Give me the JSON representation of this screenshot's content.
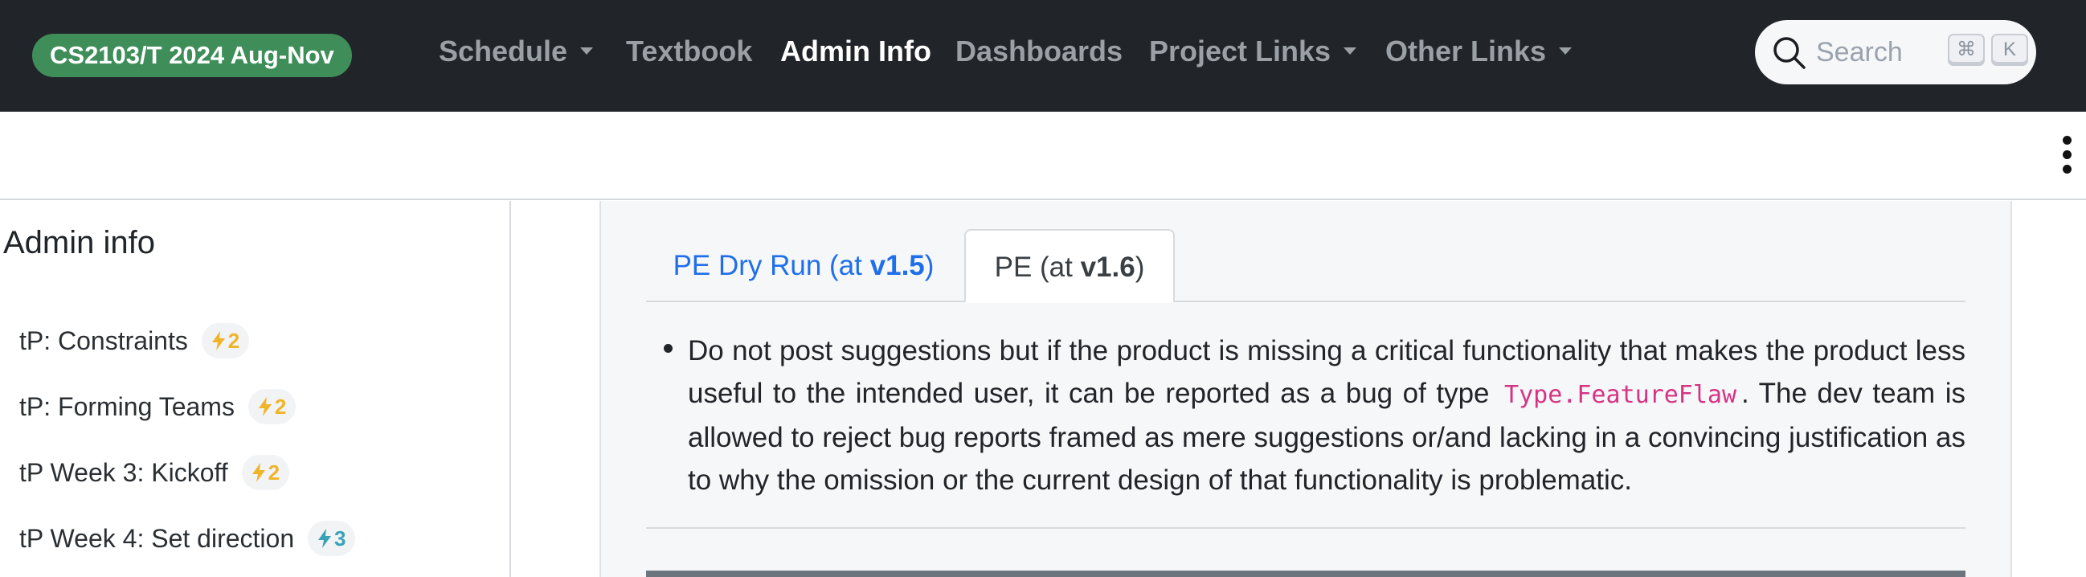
{
  "navbar": {
    "brand": "CS2103/T 2024 Aug-Nov",
    "items": [
      {
        "label": "Schedule",
        "dropdown": true,
        "active": false
      },
      {
        "label": "Textbook",
        "dropdown": false,
        "active": false
      },
      {
        "label": "Admin Info",
        "dropdown": false,
        "active": true
      },
      {
        "label": "Dashboards",
        "dropdown": false,
        "active": false
      },
      {
        "label": "Project Links",
        "dropdown": true,
        "active": false
      },
      {
        "label": "Other Links",
        "dropdown": true,
        "active": false
      }
    ],
    "search": {
      "placeholder": "Search",
      "shortcut_keys": [
        "⌘",
        "K"
      ]
    }
  },
  "subbar": {
    "menu_icon": "kebab-menu-icon"
  },
  "sidebar": {
    "title": "Admin info",
    "items": [
      {
        "label": "tP: Constraints",
        "badge": "2",
        "badge_color": "#f0b429"
      },
      {
        "label": "tP: Forming Teams",
        "badge": "2",
        "badge_color": "#f0b429"
      },
      {
        "label": "tP Week 3: Kickoff",
        "badge": "2",
        "badge_color": "#f0b429"
      },
      {
        "label": "tP Week 4: Set direction",
        "badge": "3",
        "badge_color": "#38a3b8"
      }
    ]
  },
  "main": {
    "tabs": [
      {
        "prefix": "PE Dry Run (at ",
        "version": "v1.5",
        "suffix": ")",
        "active": false
      },
      {
        "prefix": "PE (at ",
        "version": "v1.6",
        "suffix": ")",
        "active": true
      }
    ],
    "bullet": {
      "text_before": "Do not post suggestions but if the product is missing a critical functionality that makes the product less useful to the intended user, it can be reported as a bug of type",
      "code": "Type.FeatureFlaw",
      "text_after": ". The dev team is allowed to reject bug reports framed as mere suggestions or/and lacking in a convincing justification as to why the omission or the current design of that functionality is problematic."
    }
  },
  "colors": {
    "navbar_bg": "#212529",
    "brand_bg": "#3f8e59",
    "link_blue": "#1f6feb",
    "code_pink": "#d63384"
  }
}
